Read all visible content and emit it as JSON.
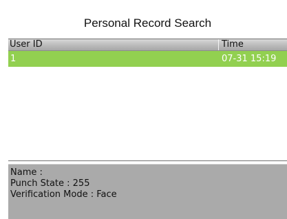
{
  "title": "Personal Record Search",
  "table": {
    "columns": [
      "User ID",
      "Time"
    ],
    "rows": [
      {
        "user_id": "1",
        "time": "07-31 15:19",
        "selected": true
      }
    ]
  },
  "details": {
    "name": "Name :",
    "punch_state": "Punch State : 255",
    "verification_mode": "Verification Mode : Face"
  },
  "colors": {
    "selected_row": "#92d050",
    "header": "#b8b8b8",
    "details_panel": "#aaaaaa"
  }
}
